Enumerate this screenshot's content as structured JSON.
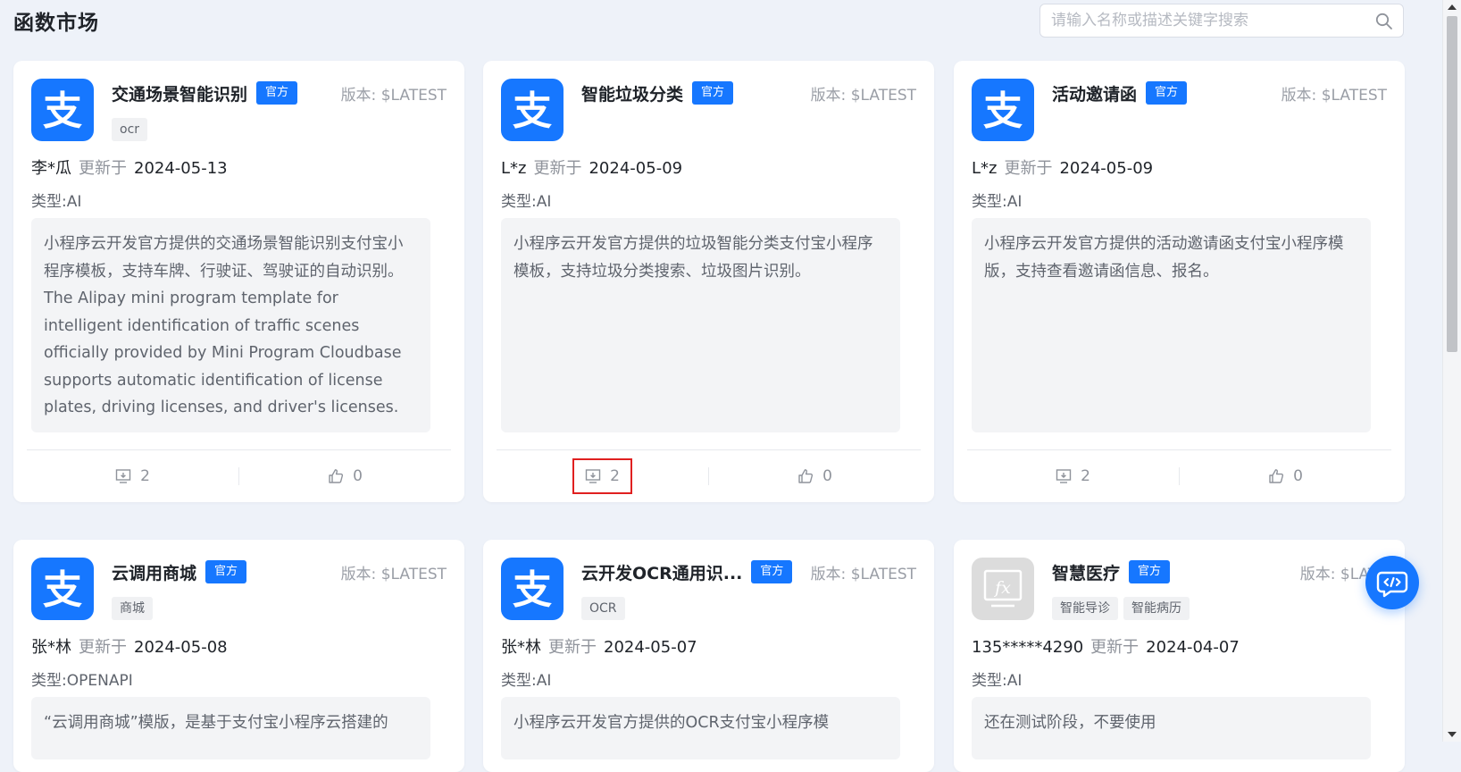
{
  "header": {
    "title": "函数市场",
    "search_placeholder": "请输入名称或描述关键字搜索"
  },
  "colors": {
    "accent": "#1677ff",
    "page_background": "#eef2f9",
    "highlight_border": "#e02020"
  },
  "labels": {
    "updated": "更新于",
    "version_prefix": "版本:",
    "type_prefix": "类型:"
  },
  "cards": [
    {
      "title": "交通场景智能识别",
      "badge": "官方",
      "version": "$LATEST",
      "tags": [
        "ocr"
      ],
      "author": "李*瓜",
      "date": "2024-05-13",
      "type": "AI",
      "description": "小程序云开发官方提供的交通场景智能识别支付宝小程序模板，支持车牌、行驶证、驾驶证的自动识别。 The Alipay mini program template for intelligent identification of traffic scenes officially provided by Mini Program Cloudbase supports automatic identification of license plates, driving licenses, and driver's licenses.",
      "downloads": "2",
      "likes": "0",
      "logo": "alipay-icon"
    },
    {
      "title": "智能垃圾分类",
      "badge": "官方",
      "version": "$LATEST",
      "tags": [],
      "author": "L*z",
      "date": "2024-05-09",
      "type": "AI",
      "description": "小程序云开发官方提供的垃圾智能分类支付宝小程序模板，支持垃圾分类搜索、垃圾图片识别。",
      "downloads": "2",
      "likes": "0",
      "logo": "alipay-icon"
    },
    {
      "title": "活动邀请函",
      "badge": "官方",
      "version": "$LATEST",
      "tags": [],
      "author": "L*z",
      "date": "2024-05-09",
      "type": "AI",
      "description": "小程序云开发官方提供的活动邀请函支付宝小程序模版，支持查看邀请函信息、报名。",
      "downloads": "2",
      "likes": "0",
      "logo": "alipay-icon"
    },
    {
      "title": "云调用商城",
      "badge": "官方",
      "version": "$LATEST",
      "tags": [
        "商城"
      ],
      "author": "张*林",
      "date": "2024-05-08",
      "type": "OPENAPI",
      "description": "“云调用商城”模版，是基于支付宝小程序云搭建的",
      "logo": "alipay-icon"
    },
    {
      "title": "云开发OCR通用识...",
      "badge": "官方",
      "version": "$LATEST",
      "tags": [
        "OCR"
      ],
      "author": "张*林",
      "date": "2024-05-07",
      "type": "AI",
      "description": "小程序云开发官方提供的OCR支付宝小程序模",
      "logo": "alipay-icon"
    },
    {
      "title": "智慧医疗",
      "badge": "官方",
      "version": "$LATE",
      "tags": [
        "智能导诊",
        "智能病历"
      ],
      "author": "135*****4290",
      "date": "2024-04-07",
      "type": "AI",
      "description": "还在测试阶段，不要使用",
      "logo": "function-icon"
    }
  ]
}
